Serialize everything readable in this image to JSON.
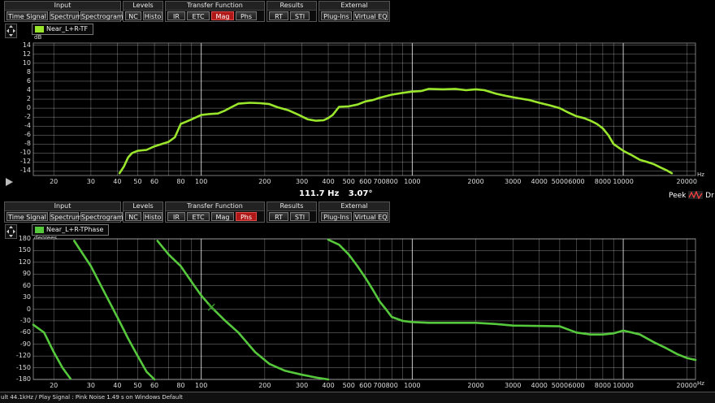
{
  "colors": {
    "trace_mag": "#9ae62c",
    "trace_phase": "#56c83c",
    "active": "#b01818",
    "grid": "#ffffff"
  },
  "toolbars": [
    {
      "groups": [
        {
          "title": "Input",
          "buttons": [
            "Time Signal",
            "Spectrum",
            "Spectrogram"
          ]
        },
        {
          "title": "Levels",
          "buttons": [
            "NC",
            "Histo"
          ]
        },
        {
          "title": "Transfer Function",
          "buttons": [
            "IR",
            "ETC",
            "Mag",
            "Phs"
          ]
        },
        {
          "title": "Results",
          "buttons": [
            "RT",
            "STI"
          ]
        },
        {
          "title": "External",
          "buttons": [
            "Plug-Ins",
            "Virtual EQ"
          ]
        }
      ],
      "active": "Mag"
    },
    {
      "groups": [
        {
          "title": "Input",
          "buttons": [
            "Time Signal",
            "Spectrum",
            "Spectrogram"
          ]
        },
        {
          "title": "Levels",
          "buttons": [
            "NC",
            "Histo"
          ]
        },
        {
          "title": "Transfer Function",
          "buttons": [
            "IR",
            "ETC",
            "Mag",
            "Phs"
          ]
        },
        {
          "title": "Results",
          "buttons": [
            "RT",
            "STI"
          ]
        },
        {
          "title": "External",
          "buttons": [
            "Plug-Ins",
            "Virtual EQ"
          ]
        }
      ],
      "active": "Phs"
    }
  ],
  "icons": {
    "navigator": "move-arrows-icon",
    "play": "play-icon",
    "peek": "peek-wave-icon"
  },
  "mag_plot": {
    "legend": "Near_L+R-TF",
    "y_unit": "dB",
    "x_unit": "Hz",
    "y_ticks": [
      "14",
      "12",
      "10",
      "8",
      "6",
      "4",
      "2",
      "0",
      "-2",
      "-4",
      "-6",
      "-8",
      "-10",
      "-12",
      "-14"
    ],
    "x_ticks": [
      "20",
      "30",
      "40",
      "50",
      "60",
      "80",
      "100",
      "200",
      "300",
      "400",
      "500",
      "600",
      "700",
      "800",
      "1000",
      "2000",
      "3000",
      "4000",
      "5000",
      "6000",
      "8000",
      "10000",
      "20000"
    ]
  },
  "readout": {
    "freq": "111.7 Hz",
    "value": "3.07°"
  },
  "peek": {
    "label": "Peek",
    "trail": "Dr"
  },
  "phase_plot": {
    "legend": "Near_L+R-TPhase",
    "y_unit": "degrees",
    "x_unit": "Hz",
    "y_ticks": [
      "180",
      "150",
      "120",
      "90",
      "60",
      "30",
      "0",
      "-30",
      "-60",
      "-90",
      "-120",
      "-150",
      "-180"
    ],
    "x_ticks": [
      "20",
      "30",
      "40",
      "50",
      "60",
      "80",
      "100",
      "200",
      "300",
      "400",
      "500",
      "600",
      "700",
      "800",
      "1000",
      "2000",
      "3000",
      "4000",
      "5000",
      "6000",
      "8000",
      "10000",
      "20000"
    ]
  },
  "status": "ult 44.1kHz / Play Signal : Pink Noise  1.49 s on Windows Default",
  "chart_data": [
    {
      "type": "line",
      "x_scale": "log",
      "ylabel": "dB",
      "xlabel": "Hz",
      "xlim": [
        16,
        22000
      ],
      "ylim": [
        -15,
        14.5
      ],
      "grid": true,
      "legend": "top-left",
      "series": [
        {
          "name": "Near_L+R-TF",
          "x": [
            41,
            43,
            45,
            47,
            50,
            55,
            60,
            65,
            70,
            75,
            80,
            85,
            90,
            100,
            110,
            120,
            130,
            140,
            150,
            170,
            190,
            210,
            230,
            260,
            290,
            320,
            350,
            380,
            400,
            420,
            450,
            500,
            550,
            600,
            650,
            700,
            800,
            900,
            1000,
            1100,
            1200,
            1400,
            1600,
            1800,
            2000,
            2200,
            2500,
            2800,
            3200,
            3600,
            4000,
            4500,
            5000,
            5500,
            6000,
            6500,
            7000,
            7500,
            8000,
            8500,
            9000,
            10000,
            11000,
            12000,
            13000,
            14000,
            15000,
            16000,
            17000
          ],
          "values": [
            -14.5,
            -13,
            -11,
            -10,
            -9.5,
            -9.3,
            -8.5,
            -8,
            -7.5,
            -6.5,
            -3.5,
            -3,
            -2.5,
            -1.5,
            -1.3,
            -1.2,
            -0.5,
            0.3,
            1,
            1.2,
            1.1,
            0.9,
            0.2,
            -0.5,
            -1.5,
            -2.5,
            -2.8,
            -2.7,
            -2.2,
            -1.5,
            0.3,
            0.4,
            0.8,
            1.5,
            1.8,
            2.3,
            3,
            3.4,
            3.7,
            3.8,
            4.3,
            4.2,
            4.3,
            4.0,
            4.2,
            4.0,
            3.2,
            2.7,
            2.2,
            1.8,
            1.2,
            0.6,
            0.0,
            -1.0,
            -1.8,
            -2.2,
            -2.8,
            -3.5,
            -4.5,
            -6.0,
            -8.0,
            -9.5,
            -10.5,
            -11.5,
            -12.0,
            -12.5,
            -13.2,
            -13.8,
            -14.5
          ]
        }
      ]
    },
    {
      "type": "line",
      "x_scale": "log",
      "ylabel": "degrees",
      "xlabel": "Hz",
      "xlim": [
        16,
        22000
      ],
      "ylim": [
        -180,
        180
      ],
      "grid": true,
      "legend": "top-left",
      "series": [
        {
          "name": "Near_L+R-TPhase",
          "segments": [
            {
              "x": [
                16,
                18,
                20,
                22,
                24
              ],
              "values": [
                -40,
                -60,
                -110,
                -150,
                -178
              ]
            },
            {
              "x": [
                25,
                30,
                35,
                40,
                45,
                50,
                55,
                60
              ],
              "values": [
                175,
                110,
                40,
                -20,
                -75,
                -120,
                -160,
                -180
              ]
            },
            {
              "x": [
                62,
                70,
                80,
                90,
                100,
                111.7,
                130,
                150,
                180,
                210,
                250,
                300,
                350,
                400
              ],
              "values": [
                175,
                140,
                110,
                70,
                35,
                5,
                -30,
                -60,
                -110,
                -140,
                -158,
                -168,
                -175,
                -180
              ]
            },
            {
              "x": [
                400,
                450,
                500,
                550,
                600,
                650,
                700,
                750,
                800,
                900,
                1000,
                1200,
                1500,
                2000,
                2500,
                3000,
                4000,
                5000,
                6000,
                7000,
                8000,
                9000,
                10000,
                11000,
                12000,
                14000,
                16000,
                18000,
                20000,
                22000
              ],
              "values": [
                178,
                165,
                140,
                110,
                80,
                50,
                20,
                0,
                -20,
                -30,
                -33,
                -35,
                -35,
                -35,
                -38,
                -42,
                -43,
                -44,
                -60,
                -65,
                -65,
                -62,
                -55,
                -60,
                -65,
                -85,
                -100,
                -115,
                -125,
                -130
              ]
            }
          ]
        }
      ]
    }
  ]
}
